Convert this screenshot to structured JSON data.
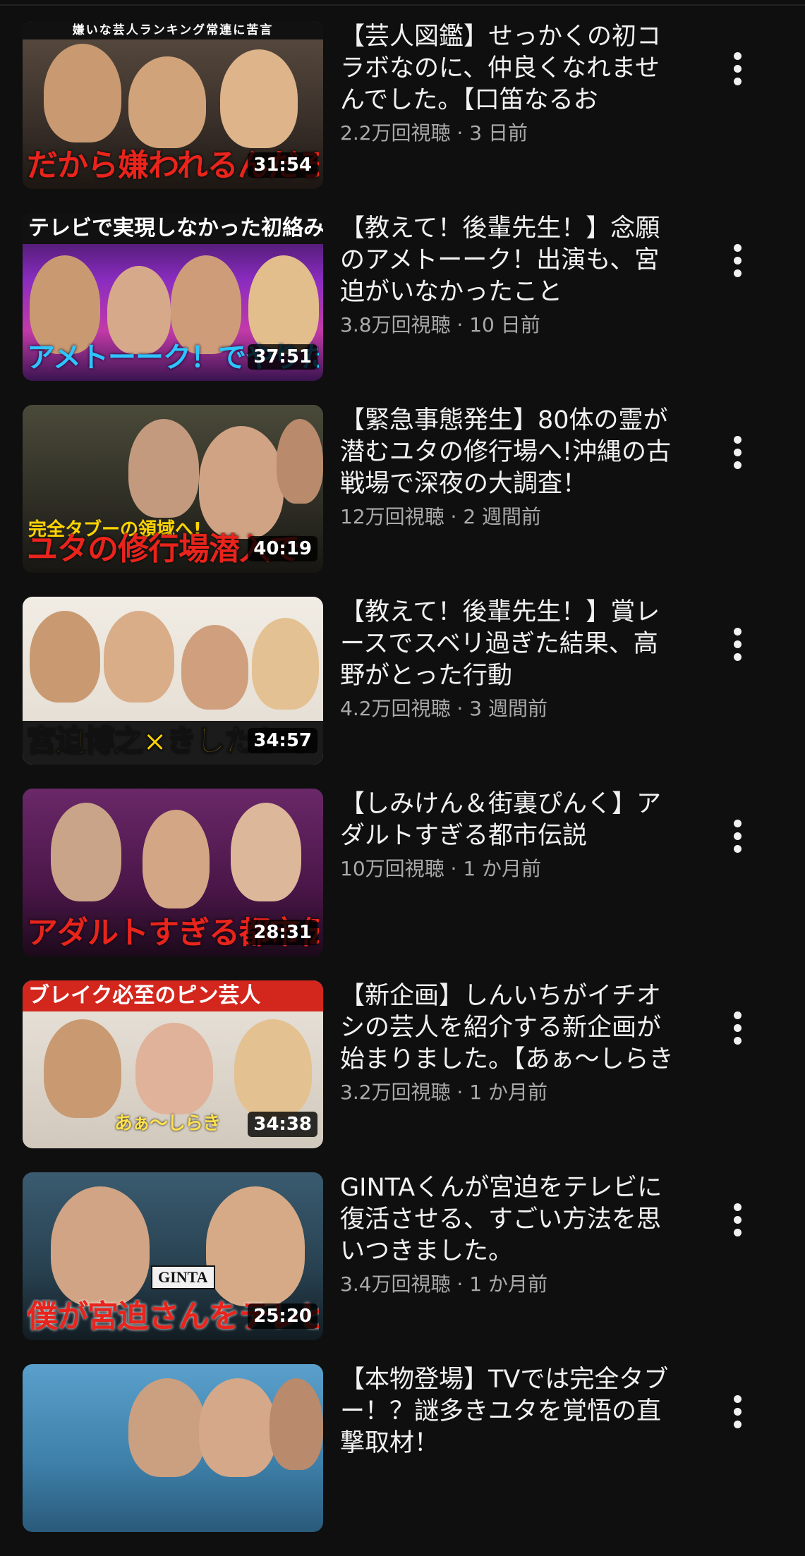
{
  "videos": [
    {
      "title": "【芸人図鑑】せっかくの初コラボなのに、仲良くなれませんでした。【口笛なるお",
      "views": "2.2万回視聴",
      "age": "3 日前",
      "meta_sep": " · ",
      "duration": "31:54",
      "thumb_ribbon": "嫌いな芸人ランキング常連に苦言",
      "thumb_caption": "だから嫌われるんだろ",
      "thumb_caption_color": "#e8241c",
      "thumb_bg": "#4a4038"
    },
    {
      "title": "【教えて！後輩先生！】念願のアメトーーク！出演も、宮迫がいなかったこと",
      "views": "3.8万回視聴",
      "age": "10 日前",
      "meta_sep": " · ",
      "duration": "37:51",
      "thumb_headline": "テレビで実現しなかった初絡み",
      "thumb_caption": "アメトーーク！でやりたかった",
      "thumb_caption_color": "#2ec4ff",
      "thumb_bg": "#7a1fa0"
    },
    {
      "title": "【緊急事態発生】80体の霊が潜むユタの修行場へ!沖縄の古戦場で深夜の大調査！",
      "views": "12万回視聴",
      "age": "2 週間前",
      "meta_sep": " · ",
      "duration": "40:19",
      "thumb_headline": "完全タブーの領域へ!",
      "thumb_caption": "ユタの修行場潜入で",
      "thumb_caption_color": "#e8241c",
      "thumb_bg": "#3b3a30"
    },
    {
      "title": "【教えて！後輩先生！】賞レースでスベリ過ぎた結果、高野がとった行動",
      "views": "4.2万回視聴",
      "age": "3 週間前",
      "meta_sep": " · ",
      "duration": "34:57",
      "thumb_caption": "宮迫博之×きしたかの",
      "thumb_caption_color": "#ffd400",
      "thumb_bg": "#e9e4dc"
    },
    {
      "title": "【しみけん＆街裏ぴんく】アダルトすぎる都市伝説",
      "views": "10万回視聴",
      "age": "1 か月前",
      "meta_sep": " · ",
      "duration": "28:31",
      "thumb_caption": "アダルトすぎる都市伝説",
      "thumb_caption_color": "#e8241c",
      "thumb_bg": "#5b1a5a"
    },
    {
      "title": "【新企画】しんいちがイチオシの芸人を紹介する新企画が始まりました。【あぁ〜しらき",
      "views": "3.2万回視聴",
      "age": "1 か月前",
      "meta_sep": " · ",
      "duration": "34:38",
      "thumb_headline": "ブレイク必至のピン芸人",
      "thumb_caption": "あぁ〜しらき",
      "thumb_caption_color": "#ffe14d",
      "thumb_bg": "#d9d2c8"
    },
    {
      "title": "GINTAくんが宮迫をテレビに復活させる、すごい方法を思いつきました。",
      "views": "3.4万回視聴",
      "age": "1 か月前",
      "meta_sep": " · ",
      "duration": "25:20",
      "thumb_label": "GINTA",
      "thumb_caption": "僕が宮迫さんをテレビに",
      "thumb_caption_color": "#e8241c",
      "thumb_bg": "#2f4a5c"
    },
    {
      "title": "【本物登場】TVでは完全タブー！？謎多きユタを覚悟の直撃取材！",
      "views": "",
      "age": "",
      "meta_sep": "",
      "duration": "",
      "thumb_caption": "",
      "thumb_caption_color": "#e8241c",
      "thumb_bg": "#3d7fa8"
    }
  ],
  "icons": {
    "more": "more-vert-icon"
  }
}
